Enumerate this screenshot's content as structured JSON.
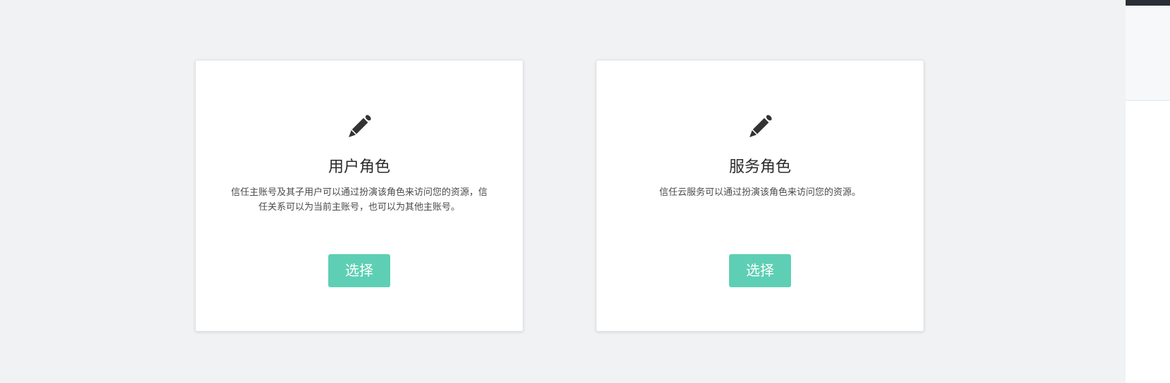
{
  "cards": [
    {
      "icon": "pencil-icon",
      "title": "用户角色",
      "description": "信任主账号及其子用户可以通过扮演该角色来访问您的资源，信任关系可以为当前主账号，也可以为其他主账号。",
      "button_label": "选择"
    },
    {
      "icon": "pencil-icon",
      "title": "服务角色",
      "description": "信任云服务可以通过扮演该角色来访问您的资源。",
      "button_label": "选择"
    }
  ],
  "colors": {
    "page_background": "#f1f2f4",
    "button": "#5ecfb4",
    "icon": "#333333"
  }
}
